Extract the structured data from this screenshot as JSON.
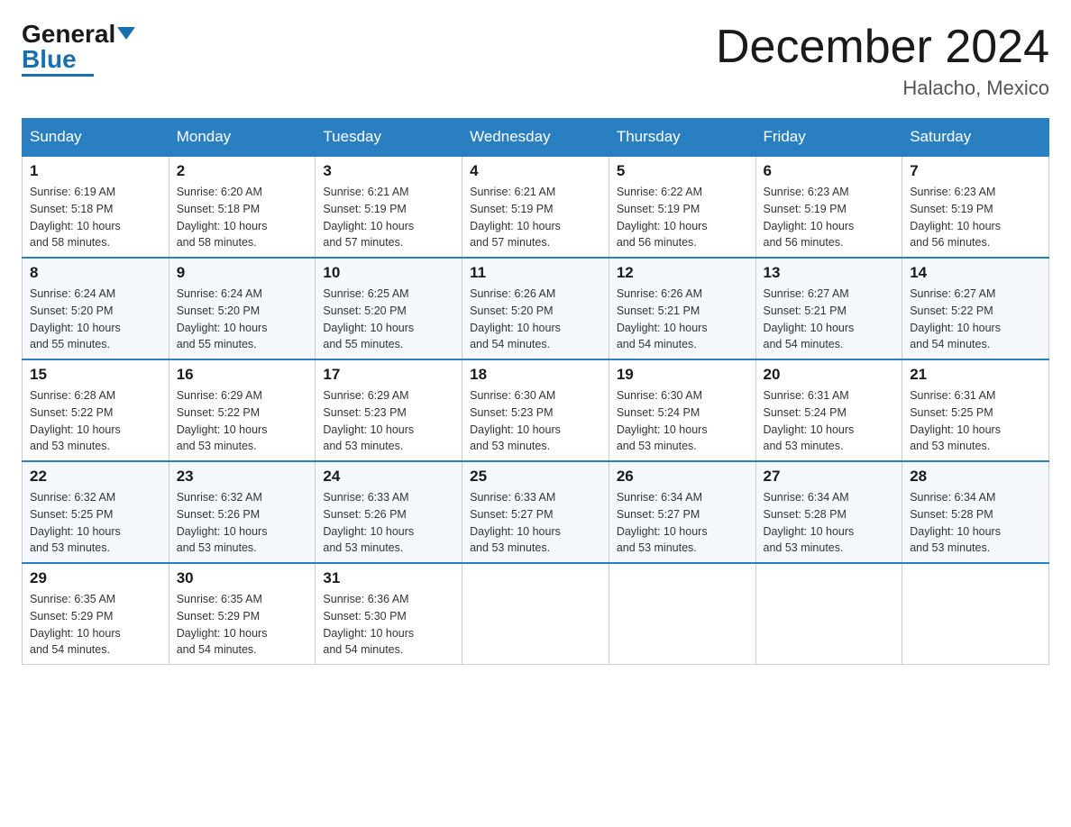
{
  "header": {
    "logo_general": "General",
    "logo_blue": "Blue",
    "month_title": "December 2024",
    "location": "Halacho, Mexico"
  },
  "days_of_week": [
    "Sunday",
    "Monday",
    "Tuesday",
    "Wednesday",
    "Thursday",
    "Friday",
    "Saturday"
  ],
  "weeks": [
    [
      {
        "day": "1",
        "sunrise": "6:19 AM",
        "sunset": "5:18 PM",
        "daylight": "10 hours and 58 minutes."
      },
      {
        "day": "2",
        "sunrise": "6:20 AM",
        "sunset": "5:18 PM",
        "daylight": "10 hours and 58 minutes."
      },
      {
        "day": "3",
        "sunrise": "6:21 AM",
        "sunset": "5:19 PM",
        "daylight": "10 hours and 57 minutes."
      },
      {
        "day": "4",
        "sunrise": "6:21 AM",
        "sunset": "5:19 PM",
        "daylight": "10 hours and 57 minutes."
      },
      {
        "day": "5",
        "sunrise": "6:22 AM",
        "sunset": "5:19 PM",
        "daylight": "10 hours and 56 minutes."
      },
      {
        "day": "6",
        "sunrise": "6:23 AM",
        "sunset": "5:19 PM",
        "daylight": "10 hours and 56 minutes."
      },
      {
        "day": "7",
        "sunrise": "6:23 AM",
        "sunset": "5:19 PM",
        "daylight": "10 hours and 56 minutes."
      }
    ],
    [
      {
        "day": "8",
        "sunrise": "6:24 AM",
        "sunset": "5:20 PM",
        "daylight": "10 hours and 55 minutes."
      },
      {
        "day": "9",
        "sunrise": "6:24 AM",
        "sunset": "5:20 PM",
        "daylight": "10 hours and 55 minutes."
      },
      {
        "day": "10",
        "sunrise": "6:25 AM",
        "sunset": "5:20 PM",
        "daylight": "10 hours and 55 minutes."
      },
      {
        "day": "11",
        "sunrise": "6:26 AM",
        "sunset": "5:20 PM",
        "daylight": "10 hours and 54 minutes."
      },
      {
        "day": "12",
        "sunrise": "6:26 AM",
        "sunset": "5:21 PM",
        "daylight": "10 hours and 54 minutes."
      },
      {
        "day": "13",
        "sunrise": "6:27 AM",
        "sunset": "5:21 PM",
        "daylight": "10 hours and 54 minutes."
      },
      {
        "day": "14",
        "sunrise": "6:27 AM",
        "sunset": "5:22 PM",
        "daylight": "10 hours and 54 minutes."
      }
    ],
    [
      {
        "day": "15",
        "sunrise": "6:28 AM",
        "sunset": "5:22 PM",
        "daylight": "10 hours and 53 minutes."
      },
      {
        "day": "16",
        "sunrise": "6:29 AM",
        "sunset": "5:22 PM",
        "daylight": "10 hours and 53 minutes."
      },
      {
        "day": "17",
        "sunrise": "6:29 AM",
        "sunset": "5:23 PM",
        "daylight": "10 hours and 53 minutes."
      },
      {
        "day": "18",
        "sunrise": "6:30 AM",
        "sunset": "5:23 PM",
        "daylight": "10 hours and 53 minutes."
      },
      {
        "day": "19",
        "sunrise": "6:30 AM",
        "sunset": "5:24 PM",
        "daylight": "10 hours and 53 minutes."
      },
      {
        "day": "20",
        "sunrise": "6:31 AM",
        "sunset": "5:24 PM",
        "daylight": "10 hours and 53 minutes."
      },
      {
        "day": "21",
        "sunrise": "6:31 AM",
        "sunset": "5:25 PM",
        "daylight": "10 hours and 53 minutes."
      }
    ],
    [
      {
        "day": "22",
        "sunrise": "6:32 AM",
        "sunset": "5:25 PM",
        "daylight": "10 hours and 53 minutes."
      },
      {
        "day": "23",
        "sunrise": "6:32 AM",
        "sunset": "5:26 PM",
        "daylight": "10 hours and 53 minutes."
      },
      {
        "day": "24",
        "sunrise": "6:33 AM",
        "sunset": "5:26 PM",
        "daylight": "10 hours and 53 minutes."
      },
      {
        "day": "25",
        "sunrise": "6:33 AM",
        "sunset": "5:27 PM",
        "daylight": "10 hours and 53 minutes."
      },
      {
        "day": "26",
        "sunrise": "6:34 AM",
        "sunset": "5:27 PM",
        "daylight": "10 hours and 53 minutes."
      },
      {
        "day": "27",
        "sunrise": "6:34 AM",
        "sunset": "5:28 PM",
        "daylight": "10 hours and 53 minutes."
      },
      {
        "day": "28",
        "sunrise": "6:34 AM",
        "sunset": "5:28 PM",
        "daylight": "10 hours and 53 minutes."
      }
    ],
    [
      {
        "day": "29",
        "sunrise": "6:35 AM",
        "sunset": "5:29 PM",
        "daylight": "10 hours and 54 minutes."
      },
      {
        "day": "30",
        "sunrise": "6:35 AM",
        "sunset": "5:29 PM",
        "daylight": "10 hours and 54 minutes."
      },
      {
        "day": "31",
        "sunrise": "6:36 AM",
        "sunset": "5:30 PM",
        "daylight": "10 hours and 54 minutes."
      },
      null,
      null,
      null,
      null
    ]
  ],
  "labels": {
    "sunrise_label": "Sunrise:",
    "sunset_label": "Sunset:",
    "daylight_label": "Daylight:"
  }
}
